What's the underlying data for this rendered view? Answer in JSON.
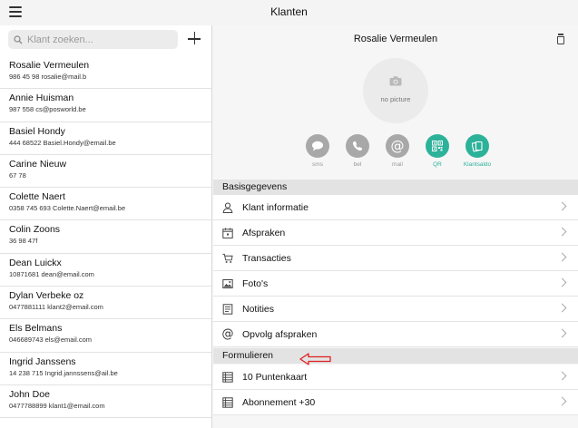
{
  "app": {
    "title": "Klanten"
  },
  "search": {
    "placeholder": "Klant zoeken..."
  },
  "customers": [
    {
      "name": "Rosalie Vermeulen",
      "sub": "986 45 98 rosalie@mail.b"
    },
    {
      "name": "Annie Huisman",
      "sub": "987 558  cs@posworld.be"
    },
    {
      "name": "Basiel Hondy",
      "sub": "444 68522  Basiel.Hondy@email.be"
    },
    {
      "name": "Carine Nieuw",
      "sub": "67 78"
    },
    {
      "name": "Colette Naert",
      "sub": "0358 745 693  Colette.Naert@email.be"
    },
    {
      "name": "Colin Zoons",
      "sub": "36 98 47f"
    },
    {
      "name": "Dean Luickx",
      "sub": "10871681  dean@email.com"
    },
    {
      "name": "Dylan Verbeke oz",
      "sub": "0477881111  klant2@email.com"
    },
    {
      "name": "Els Belmans",
      "sub": "046689743  els@email.com"
    },
    {
      "name": "Ingrid Janssens",
      "sub": "14 238 715  Ingrid.jannssens@ail.be"
    },
    {
      "name": "John Doe",
      "sub": "0477788899  klant1@email.com"
    }
  ],
  "detail": {
    "name": "Rosalie Vermeulen",
    "no_picture": "no picture",
    "actions": [
      {
        "label": "sms",
        "icon": "chat-bubble-icon",
        "color": "#a8a8a8"
      },
      {
        "label": "bel",
        "icon": "phone-icon",
        "color": "#a8a8a8"
      },
      {
        "label": "mail",
        "icon": "at-sign-icon",
        "color": "#a8a8a8"
      },
      {
        "label": "QR",
        "icon": "qr-code-icon",
        "color": "#2db29a"
      },
      {
        "label": "Klantsaldo",
        "icon": "cards-icon",
        "color": "#2db29a"
      }
    ],
    "sections": {
      "basis": "Basisgegevens",
      "formulieren": "Formulieren"
    },
    "rows": [
      {
        "label": "Klant informatie",
        "icon": "person-icon"
      },
      {
        "label": "Afspraken",
        "icon": "calendar-icon"
      },
      {
        "label": "Transacties",
        "icon": "cart-icon"
      },
      {
        "label": "Foto's",
        "icon": "photo-icon"
      },
      {
        "label": "Notities",
        "icon": "note-icon"
      },
      {
        "label": "Opvolg afspraken",
        "icon": "at-sign-icon"
      }
    ],
    "form_rows": [
      {
        "label": "10 Puntenkaart",
        "icon": "form-icon"
      },
      {
        "label": "Abonnement +30",
        "icon": "form-icon"
      }
    ]
  },
  "colors": {
    "accent": "#2db29a",
    "annotation": "#e02020"
  }
}
